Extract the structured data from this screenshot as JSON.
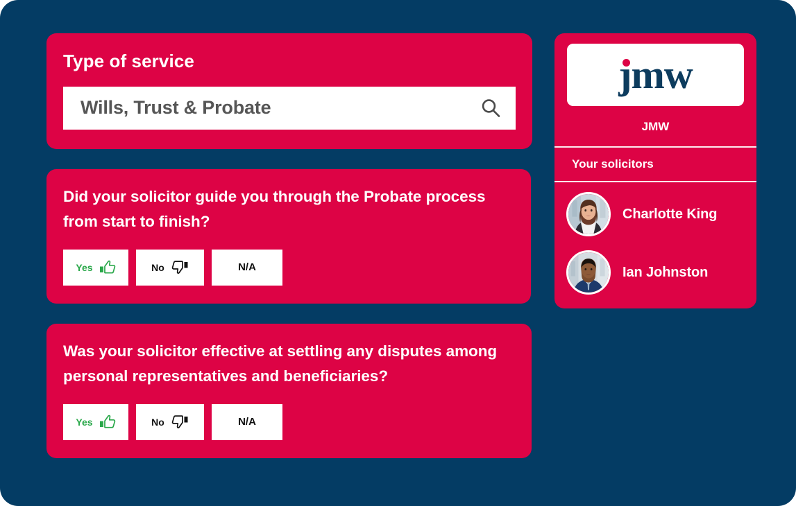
{
  "theme": {
    "background": "#043c64",
    "card": "#dd0345",
    "card_text": "#ffffff",
    "field_background": "#ffffff",
    "field_text": "#565656",
    "yes_accent": "#2aa84a",
    "no_accent": "#111111",
    "logo_navy": "#0d3c5e"
  },
  "service": {
    "title": "Type of service",
    "search_value": "Wills, Trust & Probate",
    "search_placeholder": "Type of service",
    "search_icon": "search-icon"
  },
  "answers": {
    "yes": "Yes",
    "no": "No",
    "na": "N/A",
    "yes_icon": "thumbs-up-icon",
    "no_icon": "thumbs-down-icon"
  },
  "questions": [
    {
      "text": "Did your solicitor guide you through the Probate process from start to finish?"
    },
    {
      "text": "Was your solicitor effective at settling any disputes among personal representatives and beneficiaries?"
    }
  ],
  "sidebar": {
    "logo_text": "jmw",
    "firm_name": "JMW",
    "solicitors_label": "Your solicitors",
    "solicitors": [
      {
        "name": "Charlotte King",
        "avatar": "avatar-charlotte-king"
      },
      {
        "name": "Ian Johnston",
        "avatar": "avatar-ian-johnston"
      }
    ]
  }
}
